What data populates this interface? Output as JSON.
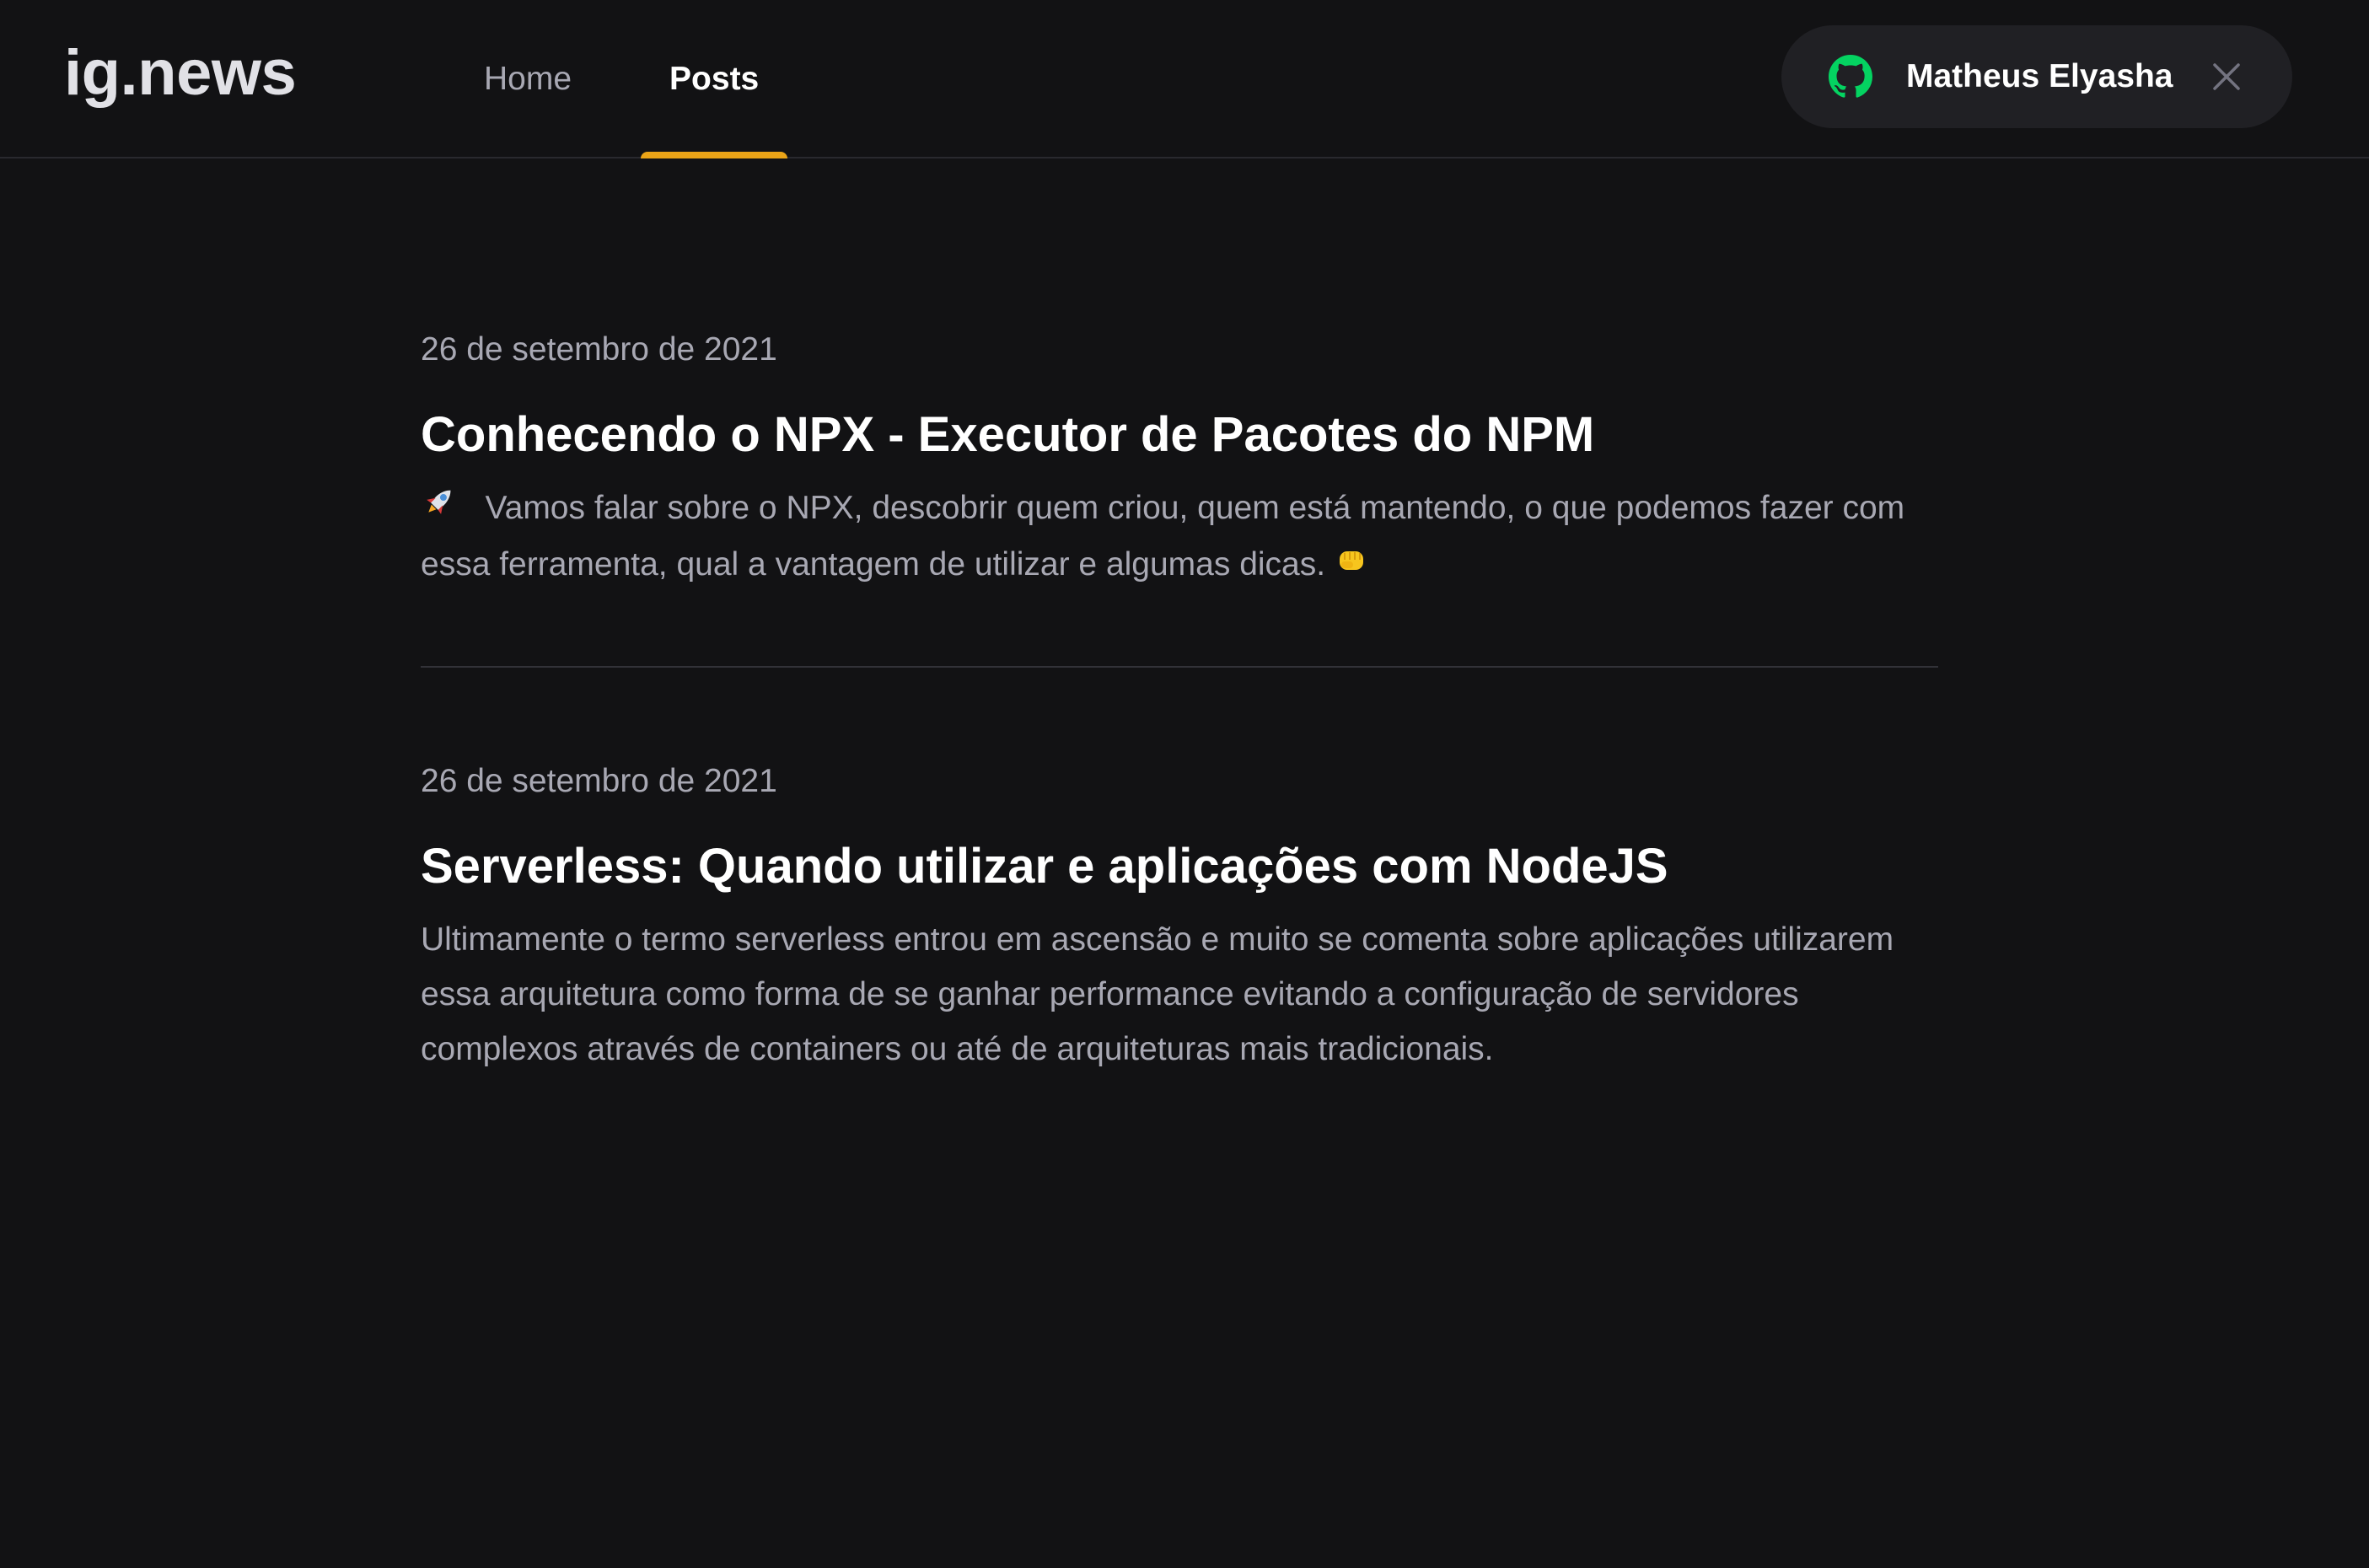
{
  "header": {
    "logo": "ig.news",
    "nav": [
      {
        "label": "Home",
        "active": false
      },
      {
        "label": "Posts",
        "active": true
      }
    ],
    "signin": {
      "user_name": "Matheus Elyasha",
      "icon": "github-icon",
      "icon_color": "#04d361",
      "close_icon": "close-icon"
    },
    "accent_color": "#eba417"
  },
  "posts": [
    {
      "date": "26 de setembro de 2021",
      "title": "Conhecendo o NPX - Executor de Pacotes do NPM",
      "excerpt_lead_icon": "rocket-emoji",
      "excerpt": "Vamos falar sobre o NPX, descobrir quem criou, quem está mantendo, o que podemos fazer com essa ferramenta, qual a vantagem de utilizar e algumas dicas.",
      "excerpt_trail_icon": "fist-bump-emoji"
    },
    {
      "date": "26 de setembro de 2021",
      "title": "Serverless: Quando utilizar e aplicações com NodeJS",
      "excerpt": "Ultimamente o termo serverless entrou em ascensão e muito se comenta sobre aplicações utilizarem essa arquitetura como forma de se ganhar performance evitando a configuração de servidores complexos através de containers ou até de arquiteturas mais tradicionais."
    }
  ]
}
